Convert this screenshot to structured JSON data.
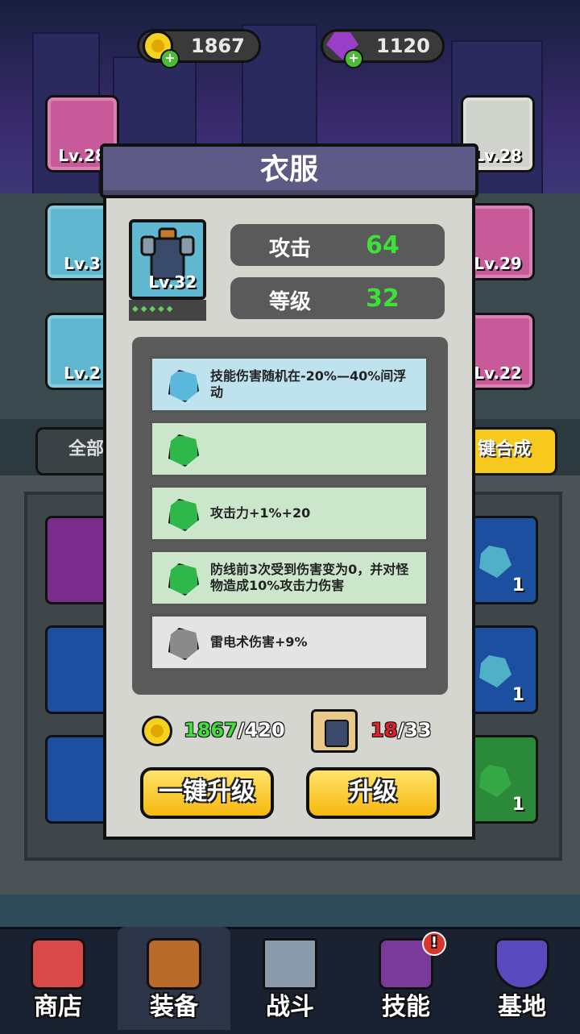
{
  "currency": {
    "coins": "1867",
    "gems": "1120"
  },
  "side_cards": {
    "necklace_level": "Lv.28",
    "rifle_level": "Lv.28",
    "armor_level": "Lv.3",
    "gloves_level": "Lv.29",
    "boots_level": "Lv.2",
    "belt_level": "Lv.22"
  },
  "side_buttons": {
    "all_label": "全部",
    "merge_label": "键合成"
  },
  "inventory": {
    "counts": [
      "1",
      "1",
      "1"
    ]
  },
  "dialog": {
    "title": "衣服",
    "item_level": "Lv.32",
    "stats": [
      {
        "label": "攻击",
        "value": "64"
      },
      {
        "label": "等级",
        "value": "32"
      }
    ],
    "attributes": [
      {
        "text": "技能伤害随机在-20%—40%间浮动",
        "rarity": "blue"
      },
      {
        "text": "",
        "rarity": "green"
      },
      {
        "text": "攻击力+1%+20",
        "rarity": "green"
      },
      {
        "text": "防线前3次受到伤害变为0，并对怪物造成10%攻击力伤害",
        "rarity": "green"
      },
      {
        "text": "雷电术伤害+9%",
        "rarity": "gray"
      }
    ],
    "cost": {
      "coins_have": "1867",
      "coins_need": "/420",
      "pieces_have": "18",
      "pieces_need": "/33"
    },
    "buttons": {
      "upgrade_all": "一键升级",
      "upgrade": "升级"
    }
  },
  "nav": {
    "items": [
      {
        "label": "商店"
      },
      {
        "label": "装备"
      },
      {
        "label": "战斗"
      },
      {
        "label": "技能"
      },
      {
        "label": "基地"
      }
    ],
    "selected": "装备",
    "skill_badge": "!"
  },
  "colors": {
    "accent_green": "#3ee03a",
    "pieces_red": "#e0202a",
    "button_yellow": "#f5b80e",
    "dialog_header": "#5d5b85"
  }
}
